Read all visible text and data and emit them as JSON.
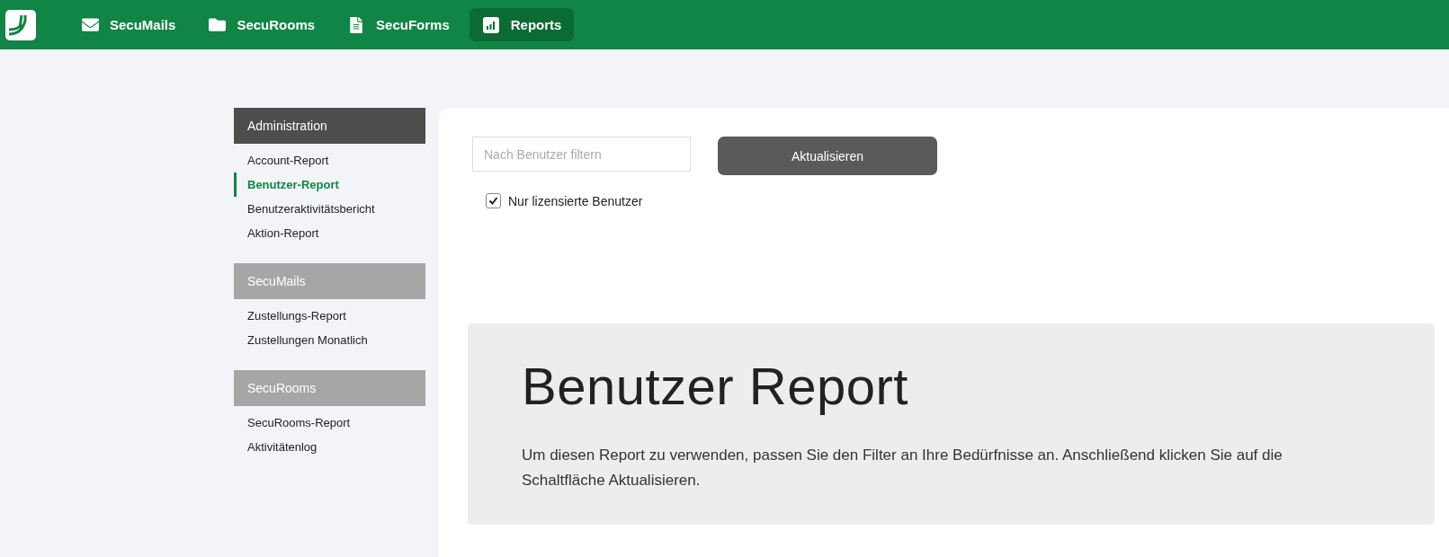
{
  "topbar": {
    "tabs": [
      {
        "label": "SecuMails",
        "selected": false
      },
      {
        "label": "SecuRooms",
        "selected": false
      },
      {
        "label": "SecuForms",
        "selected": false
      },
      {
        "label": "Reports",
        "selected": true
      }
    ]
  },
  "sidebar": {
    "sections": [
      {
        "title": "Administration",
        "active": true,
        "items": [
          {
            "label": "Account-Report",
            "selected": false
          },
          {
            "label": "Benutzer-Report",
            "selected": true
          },
          {
            "label": "Benutzeraktivitätsbericht",
            "selected": false
          },
          {
            "label": "Aktion-Report",
            "selected": false
          }
        ]
      },
      {
        "title": "SecuMails",
        "active": false,
        "items": [
          {
            "label": "Zustellungs-Report",
            "selected": false
          },
          {
            "label": "Zustellungen Monatlich",
            "selected": false
          }
        ]
      },
      {
        "title": "SecuRooms",
        "active": false,
        "items": [
          {
            "label": "SecuRooms-Report",
            "selected": false
          },
          {
            "label": "Aktivitätenlog",
            "selected": false
          }
        ]
      }
    ]
  },
  "filter": {
    "search": {
      "placeholder": "Nach Benutzer filtern"
    },
    "button": "Aktualisieren",
    "checkbox": {
      "label": "Nur lizensierte Benutzer",
      "checked": true
    }
  },
  "info": {
    "title": "Benutzer Report",
    "text": "Um diesen Report zu verwenden, passen Sie den Filter an Ihre Bedürfnisse an. Anschließend klicken Sie auf die Schaltfläche Aktualisieren."
  }
}
